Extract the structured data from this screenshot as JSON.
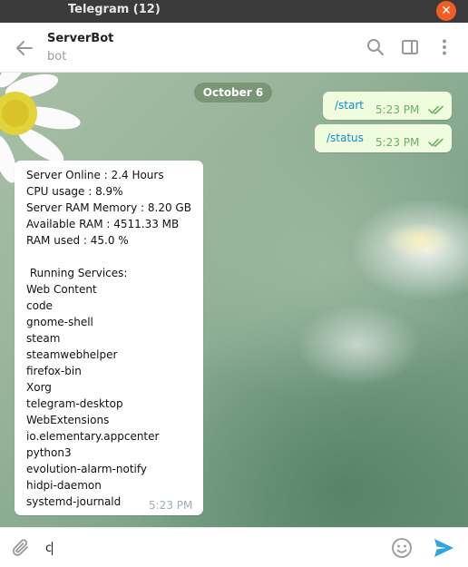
{
  "window": {
    "title": "Telegram (12)"
  },
  "chat": {
    "name": "ServerBot",
    "status": "bot"
  },
  "date_label": "October 6",
  "outgoing": [
    {
      "text": "/start",
      "time": "5:23 PM",
      "read": true
    },
    {
      "text": "/status",
      "time": "5:23 PM",
      "read": true
    }
  ],
  "incoming": {
    "lines": [
      "Server Online : 2.4 Hours",
      "CPU usage : 8.9%",
      "Server RAM Memory : 8.20 GB",
      "Available RAM : 4511.33 MB",
      "RAM used : 45.0 %",
      "",
      " Running Services:",
      "Web Content",
      "code",
      "gnome-shell",
      "steam",
      "steamwebhelper",
      "firefox-bin",
      "Xorg",
      "telegram-desktop",
      "WebExtensions",
      "io.elementary.appcenter",
      "python3",
      "evolution-alarm-notify",
      "hidpi-daemon",
      "systemd-journald"
    ],
    "time": "5:23 PM"
  },
  "composer": {
    "value": "c",
    "placeholder": ""
  },
  "icons": {
    "close": "close-icon",
    "back": "back-arrow-icon",
    "search": "search-icon",
    "sidebar": "sidebar-toggle-icon",
    "more": "more-vertical-icon",
    "attach": "paperclip-icon",
    "emoji": "emoji-icon",
    "send": "send-icon",
    "read": "double-check-icon"
  },
  "colors": {
    "titlebar": "#3b3b3b",
    "close": "#f15d22",
    "accent": "#2ea6e0",
    "outgoing_bubble": "#effdde",
    "read_ticks": "#6cb164",
    "command_link": "#168acd",
    "date_pill": "#6e8c69"
  }
}
